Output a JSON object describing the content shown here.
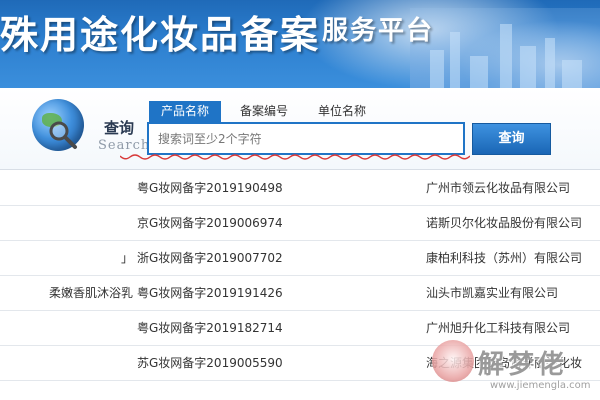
{
  "banner": {
    "title": "殊用途化妆品备案",
    "subtitle": "服务平台"
  },
  "search": {
    "logo_label": "查询",
    "logo_sub": "Search",
    "tabs": [
      {
        "label": "产品名称",
        "active": true
      },
      {
        "label": "备案编号",
        "active": false
      },
      {
        "label": "单位名称",
        "active": false
      }
    ],
    "placeholder": "搜索词至少2个字符",
    "button_label": "查询"
  },
  "results": [
    {
      "name": "",
      "code": "粤G妆网备字2019190498",
      "company": "广州市领云化妆品有限公司"
    },
    {
      "name": "",
      "code": "京G妆网备字2019006974",
      "company": "诺斯贝尔化妆品股份有限公司"
    },
    {
      "name": "」",
      "code": "浙G妆网备字2019007702",
      "company": "康柏利科技（苏州）有限公司"
    },
    {
      "name": "柔嫩香肌沐浴乳",
      "code": "粤G妆网备字2019191426",
      "company": "汕头市凯嘉实业有限公司"
    },
    {
      "name": "",
      "code": "粤G妆网备字2019182714",
      "company": "广州旭升化工科技有限公司"
    },
    {
      "name": "",
      "code": "苏G妆网备字2019005590",
      "company": "海之源集团青岛海洋丽姿化妆"
    }
  ],
  "watermark": {
    "text": "解梦佬",
    "url": "www.jiemengla.com"
  },
  "colors": {
    "brand_blue": "#1f74c6",
    "banner_top": "#1f6ab8",
    "row_border": "#e3e7ec"
  }
}
